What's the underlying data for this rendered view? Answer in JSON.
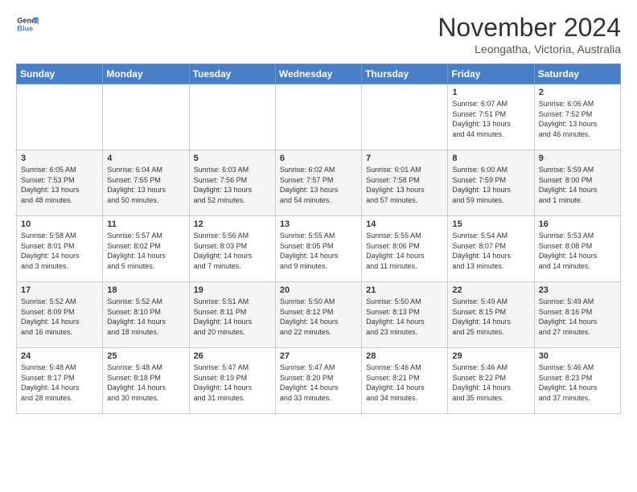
{
  "header": {
    "logo_line1": "General",
    "logo_line2": "Blue",
    "month": "November 2024",
    "location": "Leongatha, Victoria, Australia"
  },
  "weekdays": [
    "Sunday",
    "Monday",
    "Tuesday",
    "Wednesday",
    "Thursday",
    "Friday",
    "Saturday"
  ],
  "weeks": [
    [
      {
        "day": "",
        "info": ""
      },
      {
        "day": "",
        "info": ""
      },
      {
        "day": "",
        "info": ""
      },
      {
        "day": "",
        "info": ""
      },
      {
        "day": "",
        "info": ""
      },
      {
        "day": "1",
        "info": "Sunrise: 6:07 AM\nSunset: 7:51 PM\nDaylight: 13 hours\nand 44 minutes."
      },
      {
        "day": "2",
        "info": "Sunrise: 6:06 AM\nSunset: 7:52 PM\nDaylight: 13 hours\nand 46 minutes."
      }
    ],
    [
      {
        "day": "3",
        "info": "Sunrise: 6:05 AM\nSunset: 7:53 PM\nDaylight: 13 hours\nand 48 minutes."
      },
      {
        "day": "4",
        "info": "Sunrise: 6:04 AM\nSunset: 7:55 PM\nDaylight: 13 hours\nand 50 minutes."
      },
      {
        "day": "5",
        "info": "Sunrise: 6:03 AM\nSunset: 7:56 PM\nDaylight: 13 hours\nand 52 minutes."
      },
      {
        "day": "6",
        "info": "Sunrise: 6:02 AM\nSunset: 7:57 PM\nDaylight: 13 hours\nand 54 minutes."
      },
      {
        "day": "7",
        "info": "Sunrise: 6:01 AM\nSunset: 7:58 PM\nDaylight: 13 hours\nand 57 minutes."
      },
      {
        "day": "8",
        "info": "Sunrise: 6:00 AM\nSunset: 7:59 PM\nDaylight: 13 hours\nand 59 minutes."
      },
      {
        "day": "9",
        "info": "Sunrise: 5:59 AM\nSunset: 8:00 PM\nDaylight: 14 hours\nand 1 minute."
      }
    ],
    [
      {
        "day": "10",
        "info": "Sunrise: 5:58 AM\nSunset: 8:01 PM\nDaylight: 14 hours\nand 3 minutes."
      },
      {
        "day": "11",
        "info": "Sunrise: 5:57 AM\nSunset: 8:02 PM\nDaylight: 14 hours\nand 5 minutes."
      },
      {
        "day": "12",
        "info": "Sunrise: 5:56 AM\nSunset: 8:03 PM\nDaylight: 14 hours\nand 7 minutes."
      },
      {
        "day": "13",
        "info": "Sunrise: 5:55 AM\nSunset: 8:05 PM\nDaylight: 14 hours\nand 9 minutes."
      },
      {
        "day": "14",
        "info": "Sunrise: 5:55 AM\nSunset: 8:06 PM\nDaylight: 14 hours\nand 11 minutes."
      },
      {
        "day": "15",
        "info": "Sunrise: 5:54 AM\nSunset: 8:07 PM\nDaylight: 14 hours\nand 13 minutes."
      },
      {
        "day": "16",
        "info": "Sunrise: 5:53 AM\nSunset: 8:08 PM\nDaylight: 14 hours\nand 14 minutes."
      }
    ],
    [
      {
        "day": "17",
        "info": "Sunrise: 5:52 AM\nSunset: 8:09 PM\nDaylight: 14 hours\nand 16 minutes."
      },
      {
        "day": "18",
        "info": "Sunrise: 5:52 AM\nSunset: 8:10 PM\nDaylight: 14 hours\nand 18 minutes."
      },
      {
        "day": "19",
        "info": "Sunrise: 5:51 AM\nSunset: 8:11 PM\nDaylight: 14 hours\nand 20 minutes."
      },
      {
        "day": "20",
        "info": "Sunrise: 5:50 AM\nSunset: 8:12 PM\nDaylight: 14 hours\nand 22 minutes."
      },
      {
        "day": "21",
        "info": "Sunrise: 5:50 AM\nSunset: 8:13 PM\nDaylight: 14 hours\nand 23 minutes."
      },
      {
        "day": "22",
        "info": "Sunrise: 5:49 AM\nSunset: 8:15 PM\nDaylight: 14 hours\nand 25 minutes."
      },
      {
        "day": "23",
        "info": "Sunrise: 5:49 AM\nSunset: 8:16 PM\nDaylight: 14 hours\nand 27 minutes."
      }
    ],
    [
      {
        "day": "24",
        "info": "Sunrise: 5:48 AM\nSunset: 8:17 PM\nDaylight: 14 hours\nand 28 minutes."
      },
      {
        "day": "25",
        "info": "Sunrise: 5:48 AM\nSunset: 8:18 PM\nDaylight: 14 hours\nand 30 minutes."
      },
      {
        "day": "26",
        "info": "Sunrise: 5:47 AM\nSunset: 8:19 PM\nDaylight: 14 hours\nand 31 minutes."
      },
      {
        "day": "27",
        "info": "Sunrise: 5:47 AM\nSunset: 8:20 PM\nDaylight: 14 hours\nand 33 minutes."
      },
      {
        "day": "28",
        "info": "Sunrise: 5:46 AM\nSunset: 8:21 PM\nDaylight: 14 hours\nand 34 minutes."
      },
      {
        "day": "29",
        "info": "Sunrise: 5:46 AM\nSunset: 8:22 PM\nDaylight: 14 hours\nand 35 minutes."
      },
      {
        "day": "30",
        "info": "Sunrise: 5:46 AM\nSunset: 8:23 PM\nDaylight: 14 hours\nand 37 minutes."
      }
    ]
  ]
}
